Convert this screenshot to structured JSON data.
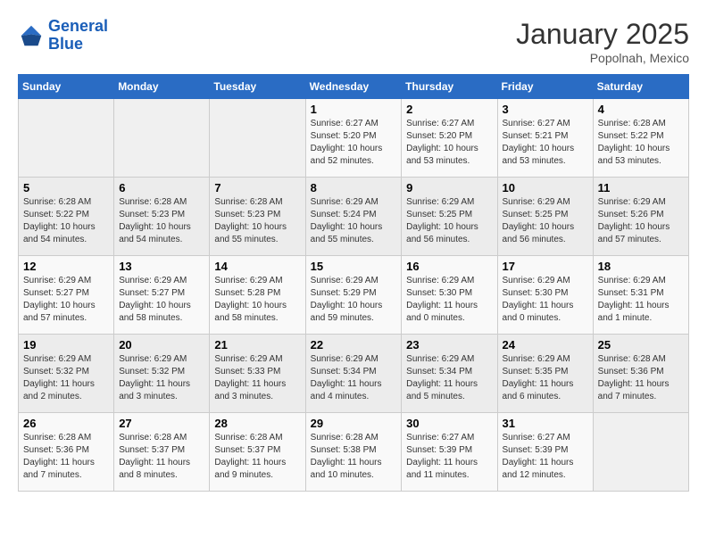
{
  "header": {
    "logo_line1": "General",
    "logo_line2": "Blue",
    "month": "January 2025",
    "location": "Popolnah, Mexico"
  },
  "weekdays": [
    "Sunday",
    "Monday",
    "Tuesday",
    "Wednesday",
    "Thursday",
    "Friday",
    "Saturday"
  ],
  "weeks": [
    [
      {
        "day": "",
        "info": ""
      },
      {
        "day": "",
        "info": ""
      },
      {
        "day": "",
        "info": ""
      },
      {
        "day": "1",
        "info": "Sunrise: 6:27 AM\nSunset: 5:20 PM\nDaylight: 10 hours\nand 52 minutes."
      },
      {
        "day": "2",
        "info": "Sunrise: 6:27 AM\nSunset: 5:20 PM\nDaylight: 10 hours\nand 53 minutes."
      },
      {
        "day": "3",
        "info": "Sunrise: 6:27 AM\nSunset: 5:21 PM\nDaylight: 10 hours\nand 53 minutes."
      },
      {
        "day": "4",
        "info": "Sunrise: 6:28 AM\nSunset: 5:22 PM\nDaylight: 10 hours\nand 53 minutes."
      }
    ],
    [
      {
        "day": "5",
        "info": "Sunrise: 6:28 AM\nSunset: 5:22 PM\nDaylight: 10 hours\nand 54 minutes."
      },
      {
        "day": "6",
        "info": "Sunrise: 6:28 AM\nSunset: 5:23 PM\nDaylight: 10 hours\nand 54 minutes."
      },
      {
        "day": "7",
        "info": "Sunrise: 6:28 AM\nSunset: 5:23 PM\nDaylight: 10 hours\nand 55 minutes."
      },
      {
        "day": "8",
        "info": "Sunrise: 6:29 AM\nSunset: 5:24 PM\nDaylight: 10 hours\nand 55 minutes."
      },
      {
        "day": "9",
        "info": "Sunrise: 6:29 AM\nSunset: 5:25 PM\nDaylight: 10 hours\nand 56 minutes."
      },
      {
        "day": "10",
        "info": "Sunrise: 6:29 AM\nSunset: 5:25 PM\nDaylight: 10 hours\nand 56 minutes."
      },
      {
        "day": "11",
        "info": "Sunrise: 6:29 AM\nSunset: 5:26 PM\nDaylight: 10 hours\nand 57 minutes."
      }
    ],
    [
      {
        "day": "12",
        "info": "Sunrise: 6:29 AM\nSunset: 5:27 PM\nDaylight: 10 hours\nand 57 minutes."
      },
      {
        "day": "13",
        "info": "Sunrise: 6:29 AM\nSunset: 5:27 PM\nDaylight: 10 hours\nand 58 minutes."
      },
      {
        "day": "14",
        "info": "Sunrise: 6:29 AM\nSunset: 5:28 PM\nDaylight: 10 hours\nand 58 minutes."
      },
      {
        "day": "15",
        "info": "Sunrise: 6:29 AM\nSunset: 5:29 PM\nDaylight: 10 hours\nand 59 minutes."
      },
      {
        "day": "16",
        "info": "Sunrise: 6:29 AM\nSunset: 5:30 PM\nDaylight: 11 hours\nand 0 minutes."
      },
      {
        "day": "17",
        "info": "Sunrise: 6:29 AM\nSunset: 5:30 PM\nDaylight: 11 hours\nand 0 minutes."
      },
      {
        "day": "18",
        "info": "Sunrise: 6:29 AM\nSunset: 5:31 PM\nDaylight: 11 hours\nand 1 minute."
      }
    ],
    [
      {
        "day": "19",
        "info": "Sunrise: 6:29 AM\nSunset: 5:32 PM\nDaylight: 11 hours\nand 2 minutes."
      },
      {
        "day": "20",
        "info": "Sunrise: 6:29 AM\nSunset: 5:32 PM\nDaylight: 11 hours\nand 3 minutes."
      },
      {
        "day": "21",
        "info": "Sunrise: 6:29 AM\nSunset: 5:33 PM\nDaylight: 11 hours\nand 3 minutes."
      },
      {
        "day": "22",
        "info": "Sunrise: 6:29 AM\nSunset: 5:34 PM\nDaylight: 11 hours\nand 4 minutes."
      },
      {
        "day": "23",
        "info": "Sunrise: 6:29 AM\nSunset: 5:34 PM\nDaylight: 11 hours\nand 5 minutes."
      },
      {
        "day": "24",
        "info": "Sunrise: 6:29 AM\nSunset: 5:35 PM\nDaylight: 11 hours\nand 6 minutes."
      },
      {
        "day": "25",
        "info": "Sunrise: 6:28 AM\nSunset: 5:36 PM\nDaylight: 11 hours\nand 7 minutes."
      }
    ],
    [
      {
        "day": "26",
        "info": "Sunrise: 6:28 AM\nSunset: 5:36 PM\nDaylight: 11 hours\nand 7 minutes."
      },
      {
        "day": "27",
        "info": "Sunrise: 6:28 AM\nSunset: 5:37 PM\nDaylight: 11 hours\nand 8 minutes."
      },
      {
        "day": "28",
        "info": "Sunrise: 6:28 AM\nSunset: 5:37 PM\nDaylight: 11 hours\nand 9 minutes."
      },
      {
        "day": "29",
        "info": "Sunrise: 6:28 AM\nSunset: 5:38 PM\nDaylight: 11 hours\nand 10 minutes."
      },
      {
        "day": "30",
        "info": "Sunrise: 6:27 AM\nSunset: 5:39 PM\nDaylight: 11 hours\nand 11 minutes."
      },
      {
        "day": "31",
        "info": "Sunrise: 6:27 AM\nSunset: 5:39 PM\nDaylight: 11 hours\nand 12 minutes."
      },
      {
        "day": "",
        "info": ""
      }
    ]
  ]
}
